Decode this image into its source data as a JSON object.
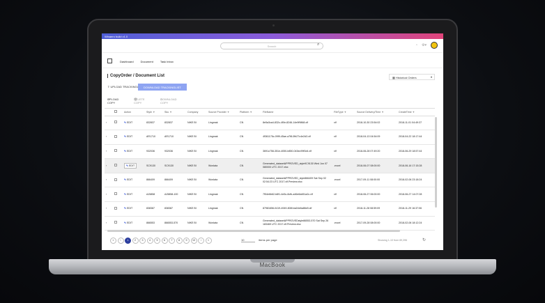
{
  "laptop": {
    "brand": "MacBook"
  },
  "app": {
    "build_label": "Winaero build v1.0",
    "search": {
      "placeholder": "Search"
    },
    "nav": [
      "Dashboard",
      "Document",
      "Task Inbox"
    ],
    "breadcrumb": {
      "parent": "CopyOrder",
      "sep": "/",
      "current": "Document List"
    },
    "history_select": {
      "icon": "calendar-icon",
      "value": "Historical Orders"
    },
    "actions": {
      "upload_tracking": "UPLOAD TRACKINGLIST",
      "download_tracking": "DOWNLOAD TRACKINGLIST",
      "upload_copy": "UPLOAD COPY",
      "delete_copy": "DELETE COPY",
      "download_copy": "DOWNLOAD COPY"
    },
    "accent": "#8ea4f2",
    "table": {
      "columns": [
        "",
        "",
        "Action",
        "Style",
        "Sku",
        "Company",
        "Source Provider",
        "Platform",
        "FileName",
        "FileType",
        "Source Delivery/Time",
        "CreateTime"
      ],
      "rows": [
        {
          "action": "EDIT",
          "style": "832837",
          "sku": "832837",
          "company": "NIKE BI",
          "provider": "Lingmak",
          "platform": "CN",
          "file": "8e5a3ca4-832c-4f0e-8246-14e9f9868.xlf",
          "type": "xlf",
          "delivery": "2018-10-30 23:54:02",
          "create": "2018-11-01 04:49:37",
          "selected": false
        },
        {
          "action": "EDIT",
          "style": "AR1710",
          "sku": "AR1710",
          "company": "NIKE BI",
          "provider": "Lingmak",
          "platform": "CN",
          "file": "4f361176c-09f9-45ae-a7f8-0fb27c4e2d3.xlf",
          "type": "xlf",
          "delivery": "2018-04-13 04:54:09",
          "create": "2018-04-22 18:17:44",
          "selected": false
        },
        {
          "action": "EDIT",
          "style": "932036",
          "sku": "932036",
          "company": "NIKE BI",
          "provider": "Lingmak",
          "platform": "CN",
          "file": "3691c758-351e-4050-b850-043ec99f0d4.xlf",
          "type": "xlf",
          "delivery": "2018-06-28 07:49:20",
          "create": "2018-06-29 18:57:44",
          "selected": false
        },
        {
          "action": "EDIT",
          "style": "SC9130",
          "sku": "SC9130",
          "company": "NIKE BI",
          "provider": "Wonlata",
          "platform": "CN",
          "file": "Generated_datasetAPPROVED_style9C9130 Wed Jun 07 080000 UTC 2017.xlsx",
          "type": ".excel",
          "delivery": "2018-06-07 08:00:00",
          "create": "2018-06-16 17:15:28",
          "selected": true
        },
        {
          "action": "EDIT",
          "style": "866409",
          "sku": "866409",
          "company": "NIKE BI",
          "provider": "Wonlata",
          "platform": "CN",
          "file": "Generated_datasetAPPROVED_style866409 Sat Sep 02 02:54:23 UTC 2017.xlf.Preview.xlsx",
          "type": ".excel",
          "delivery": "2017-09-11 08:00:00",
          "create": "2018-02-06 23:18:24",
          "selected": false
        },
        {
          "action": "EDIT",
          "style": "AJ5858",
          "sku": "AJ5858-100",
          "company": "NIKE BI",
          "provider": "Lingmak",
          "platform": "CN",
          "file": "7f54e6b62-b8f1-4e5c-8cfb-a46e6dd51a2c.xlf",
          "type": "xlf",
          "delivery": "2018-06-27 06:00:00",
          "create": "2018-06-27 14:07:28",
          "selected": false
        },
        {
          "action": "EDIT",
          "style": "838387",
          "sku": "838387",
          "company": "NIKE BI",
          "provider": "Lingmak",
          "platform": "CN",
          "file": "87981656-0419-4949-808f-ba04e6a86e5.xlf",
          "type": "xlf",
          "delivery": "2018-11-28 08:59:09",
          "create": "2018-11-29 16:37:06",
          "selected": false
        },
        {
          "action": "EDIT",
          "style": "866553",
          "sku": "866553-570",
          "company": "NIKE BI",
          "provider": "Wonlata",
          "platform": "CN",
          "file": "Generated_datasetAPPROVEDstyle86553-570 Sat Sep 26 183469 UTC 2017.xlf.Preview.xlsx",
          "type": ".excel",
          "delivery": "2017-09-28 08:00:00",
          "create": "2018-02-06 18:12:24",
          "selected": false
        }
      ]
    },
    "pagination": {
      "pages": [
        "1",
        "2",
        "3",
        "4",
        "5",
        "6",
        "7",
        "8",
        "9",
        "10"
      ],
      "current": "1",
      "per_page_value": "10",
      "per_page_label": "items per page",
      "showing": "Showing 1-10 from 89,396"
    }
  }
}
